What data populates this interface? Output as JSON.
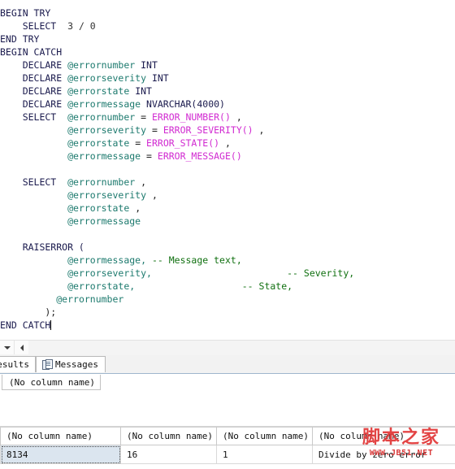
{
  "editor": {
    "language": "tsql",
    "caret_line": "END CATCH",
    "lines": [
      [
        {
          "t": "BEGIN TRY",
          "c": "kw"
        }
      ],
      [
        {
          "t": "    SELECT",
          "c": "kw"
        },
        {
          "t": "  3 / 0",
          "c": "num"
        }
      ],
      [
        {
          "t": "END TRY",
          "c": "kw"
        }
      ],
      [
        {
          "t": "BEGIN CATCH",
          "c": "kw"
        }
      ],
      [
        {
          "t": "    DECLARE ",
          "c": "kw"
        },
        {
          "t": "@errornumber",
          "c": "var"
        },
        {
          "t": " INT",
          "c": "kw"
        }
      ],
      [
        {
          "t": "    DECLARE ",
          "c": "kw"
        },
        {
          "t": "@errorseverity",
          "c": "var"
        },
        {
          "t": " INT",
          "c": "kw"
        }
      ],
      [
        {
          "t": "    DECLARE ",
          "c": "kw"
        },
        {
          "t": "@errorstate",
          "c": "var"
        },
        {
          "t": " INT",
          "c": "kw"
        }
      ],
      [
        {
          "t": "    DECLARE ",
          "c": "kw"
        },
        {
          "t": "@errormessage",
          "c": "var"
        },
        {
          "t": " NVARCHAR(4000)",
          "c": "kw"
        }
      ],
      [
        {
          "t": "    SELECT  ",
          "c": "kw"
        },
        {
          "t": "@errornumber",
          "c": "var"
        },
        {
          "t": " = ",
          "c": "plain"
        },
        {
          "t": "ERROR_NUMBER()",
          "c": "fn"
        },
        {
          "t": " ,",
          "c": "plain"
        }
      ],
      [
        {
          "t": "            ",
          "c": "plain"
        },
        {
          "t": "@errorseverity",
          "c": "var"
        },
        {
          "t": " = ",
          "c": "plain"
        },
        {
          "t": "ERROR_SEVERITY()",
          "c": "fn"
        },
        {
          "t": " ,",
          "c": "plain"
        }
      ],
      [
        {
          "t": "            ",
          "c": "plain"
        },
        {
          "t": "@errorstate",
          "c": "var"
        },
        {
          "t": " = ",
          "c": "plain"
        },
        {
          "t": "ERROR_STATE()",
          "c": "fn"
        },
        {
          "t": " ,",
          "c": "plain"
        }
      ],
      [
        {
          "t": "            ",
          "c": "plain"
        },
        {
          "t": "@errormessage",
          "c": "var"
        },
        {
          "t": " = ",
          "c": "plain"
        },
        {
          "t": "ERROR_MESSAGE()",
          "c": "fn"
        }
      ],
      [
        {
          "t": "",
          "c": "plain"
        }
      ],
      [
        {
          "t": "    SELECT  ",
          "c": "kw"
        },
        {
          "t": "@errornumber",
          "c": "var"
        },
        {
          "t": " ,",
          "c": "plain"
        }
      ],
      [
        {
          "t": "            ",
          "c": "plain"
        },
        {
          "t": "@errorseverity",
          "c": "var"
        },
        {
          "t": " ,",
          "c": "plain"
        }
      ],
      [
        {
          "t": "            ",
          "c": "plain"
        },
        {
          "t": "@errorstate",
          "c": "var"
        },
        {
          "t": " ,",
          "c": "plain"
        }
      ],
      [
        {
          "t": "            ",
          "c": "plain"
        },
        {
          "t": "@errormessage",
          "c": "var"
        }
      ],
      [
        {
          "t": "",
          "c": "plain"
        }
      ],
      [
        {
          "t": "    RAISERROR (",
          "c": "kw"
        }
      ],
      [
        {
          "t": "            ",
          "c": "plain"
        },
        {
          "t": "@errormessage,",
          "c": "var"
        },
        {
          "t": " ",
          "c": "plain"
        },
        {
          "t": "-- Message text,",
          "c": "cmt"
        }
      ],
      [
        {
          "t": "            ",
          "c": "plain"
        },
        {
          "t": "@errorseverity,",
          "c": "var"
        },
        {
          "t": "                        ",
          "c": "plain"
        },
        {
          "t": "-- Severity,",
          "c": "cmt"
        }
      ],
      [
        {
          "t": "            ",
          "c": "plain"
        },
        {
          "t": "@errorstate,",
          "c": "var"
        },
        {
          "t": "                   ",
          "c": "plain"
        },
        {
          "t": "-- State,",
          "c": "cmt"
        }
      ],
      [
        {
          "t": "          ",
          "c": "plain"
        },
        {
          "t": "@errornumber",
          "c": "var"
        }
      ],
      [
        {
          "t": "        );",
          "c": "plain"
        }
      ],
      [
        {
          "t": "END CATCH",
          "c": "kw",
          "caret": true
        }
      ]
    ]
  },
  "scrollbar": {
    "down_arrow_icon": "chevron-down-icon",
    "left_arrow_icon": "triangle-left-icon"
  },
  "tabs": [
    {
      "id": "results",
      "label": "esults",
      "icon": null,
      "selected": false
    },
    {
      "id": "messages",
      "label": "Messages",
      "icon": "grid-sheet-icon",
      "selected": true
    }
  ],
  "grid_top": {
    "header": "(No column name)"
  },
  "grid_bottom": {
    "columns": [
      "(No column name)",
      "(No column name)",
      "(No column name)",
      "(No column name)"
    ],
    "rows": [
      [
        "8134",
        "16",
        "1",
        "Divide by zero error"
      ]
    ],
    "selected_cell": {
      "row": 0,
      "col": 0
    },
    "selection_color": "#dbe5ef"
  },
  "watermark": {
    "text_cn": "脚本之家",
    "url": "WWW.JB51.NET",
    "color": "#e23b3b"
  },
  "colors": {
    "keyword": "#1a1a4d",
    "variable": "#1d7a6e",
    "function": "#d12ad1",
    "comment": "#107010",
    "background": "#ffffff"
  }
}
